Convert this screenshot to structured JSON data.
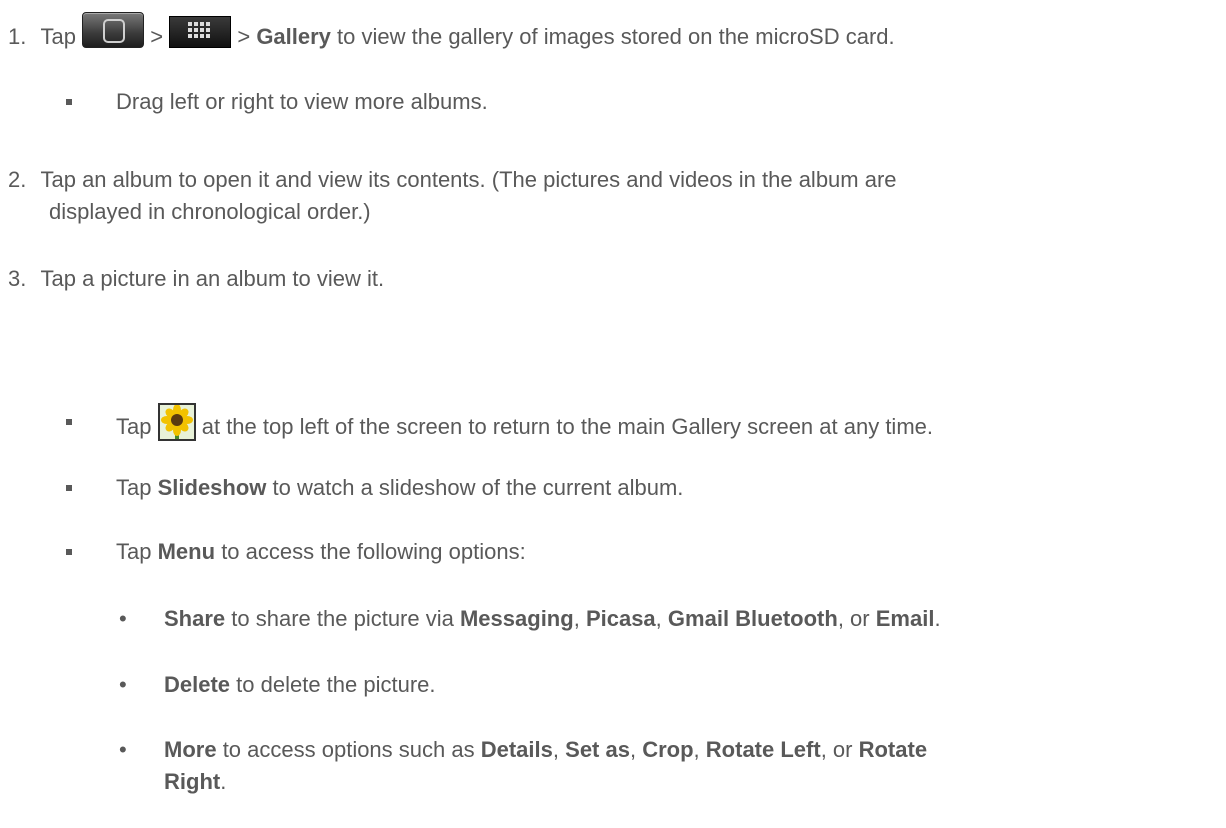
{
  "step1": {
    "num": "1.",
    "pre": "Tap",
    "sep1": ">",
    "sep2": ">",
    "bold": "Gallery",
    "post": "to view the gallery of images stored on the microSD card."
  },
  "step1_bullet": "Drag left or right to view more albums.",
  "step2": {
    "num": "2.",
    "line1": "Tap an album to open it and view its contents. (The pictures and videos in the album are",
    "line2": "displayed in chronological order.)"
  },
  "step3": {
    "num": "3.",
    "text": "Tap a picture in an album to view it."
  },
  "bullets": {
    "b1": {
      "pre": "Tap",
      "post": "at the top left of the screen to return to the main Gallery screen at any time."
    },
    "b2": {
      "pre": "Tap",
      "bold": "Slideshow",
      "post": "to watch a slideshow of the current album."
    },
    "b3": {
      "pre": "Tap",
      "bold": "Menu",
      "post": "to access the following options:"
    }
  },
  "sub": {
    "s1": {
      "b1": "Share",
      "t1": "to share the picture via",
      "b2": "Messaging",
      "t2": ",",
      "b3": "Picasa",
      "t3": ",",
      "b4": "Gmail Bluetooth",
      "t4": ", or",
      "b5": "Email",
      "t5": "."
    },
    "s2": {
      "b1": "Delete",
      "t1": "to delete the picture."
    },
    "s3": {
      "b1": "More",
      "t1": "to access options such as",
      "b2": "Details",
      "t2": ",",
      "b3": "Set as",
      "t3": ",",
      "b4": "Crop",
      "t4": ",",
      "b5": "Rotate Left",
      "t5": ", or",
      "b6": "Rotate",
      "b7": "Right",
      "t7": "."
    }
  },
  "icons": {
    "home": "home-button-icon",
    "apps": "apps-grid-icon",
    "gallery": "sunflower-gallery-icon"
  }
}
